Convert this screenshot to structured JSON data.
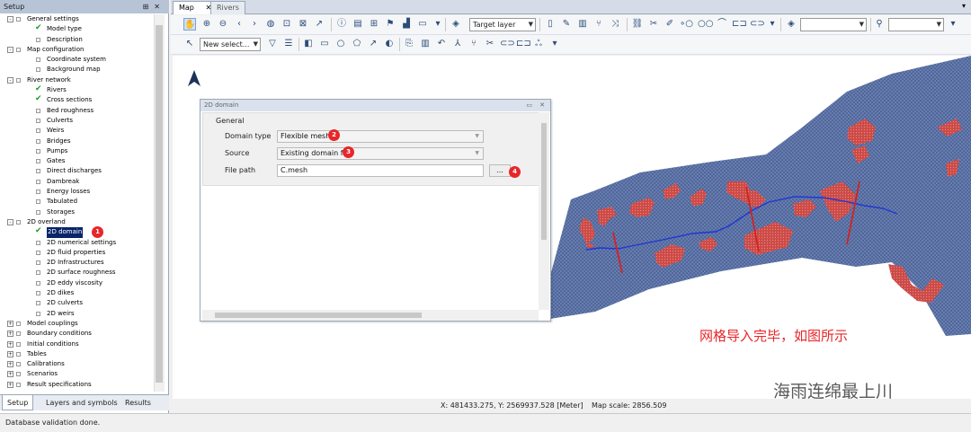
{
  "setup_panel": {
    "title": "Setup",
    "tree": [
      {
        "label": "General settings",
        "level": 0,
        "expander": "-"
      },
      {
        "label": "Model type",
        "level": 1,
        "checked": true
      },
      {
        "label": "Description",
        "level": 1
      },
      {
        "label": "Map configuration",
        "level": 0,
        "expander": "-"
      },
      {
        "label": "Coordinate system",
        "level": 1
      },
      {
        "label": "Background map",
        "level": 1
      },
      {
        "label": "River network",
        "level": 0,
        "expander": "-"
      },
      {
        "label": "Rivers",
        "level": 1,
        "checked": true
      },
      {
        "label": "Cross sections",
        "level": 1,
        "checked": true
      },
      {
        "label": "Bed roughness",
        "level": 1
      },
      {
        "label": "Culverts",
        "level": 1
      },
      {
        "label": "Weirs",
        "level": 1
      },
      {
        "label": "Bridges",
        "level": 1
      },
      {
        "label": "Pumps",
        "level": 1
      },
      {
        "label": "Gates",
        "level": 1
      },
      {
        "label": "Direct discharges",
        "level": 1
      },
      {
        "label": "Dambreak",
        "level": 1
      },
      {
        "label": "Energy losses",
        "level": 1
      },
      {
        "label": "Tabulated",
        "level": 1
      },
      {
        "label": "Storages",
        "level": 1
      },
      {
        "label": "2D overland",
        "level": 0,
        "expander": "-"
      },
      {
        "label": "2D domain",
        "level": 1,
        "checked": true,
        "selected": true,
        "badge": "1"
      },
      {
        "label": "2D numerical settings",
        "level": 1
      },
      {
        "label": "2D fluid properties",
        "level": 1
      },
      {
        "label": "2D Infrastructures",
        "level": 1
      },
      {
        "label": "2D surface roughness",
        "level": 1
      },
      {
        "label": "2D eddy viscosity",
        "level": 1
      },
      {
        "label": "2D dikes",
        "level": 1
      },
      {
        "label": "2D culverts",
        "level": 1
      },
      {
        "label": "2D weirs",
        "level": 1
      },
      {
        "label": "Model couplings",
        "level": 0,
        "expander": "+"
      },
      {
        "label": "Boundary conditions",
        "level": 0,
        "expander": "+"
      },
      {
        "label": "Initial conditions",
        "level": 0,
        "expander": "+"
      },
      {
        "label": "Tables",
        "level": 0,
        "expander": "+"
      },
      {
        "label": "Calibrations",
        "level": 0,
        "expander": "+"
      },
      {
        "label": "Scenarios",
        "level": 0,
        "expander": "+"
      },
      {
        "label": "Result specifications",
        "level": 0,
        "expander": "+"
      }
    ],
    "tabs": [
      "Setup",
      "Layers and symbols",
      "Results"
    ]
  },
  "doc_tabs": [
    "Map",
    "Rivers"
  ],
  "toolbar": {
    "target_layer": "Target layer",
    "new_select": "New select..."
  },
  "dialog": {
    "title": "2D domain",
    "group_label": "General",
    "fields": {
      "domain_type_label": "Domain type",
      "domain_type_value": "Flexible mesh",
      "domain_type_badge": "2",
      "source_label": "Source",
      "source_value": "Existing domain file",
      "source_badge": "3",
      "file_path_label": "File path",
      "file_path_value": "C.mesh",
      "browse_label": "...",
      "browse_badge": "4"
    }
  },
  "map": {
    "annotation": "网格导入完毕，如图所示",
    "watermark": "海雨连绵最上川",
    "status_coords": "X: 481433.275, Y: 2569937.528 [Meter]",
    "status_scale": "Map scale: 2856.509",
    "colors": {
      "mesh": "#4d6ea8",
      "dike": "#d14a4a",
      "river": "#1f35d6",
      "cross_section": "#d62020",
      "annotation": "#e8262a"
    }
  },
  "status_bar": "Database validation done."
}
